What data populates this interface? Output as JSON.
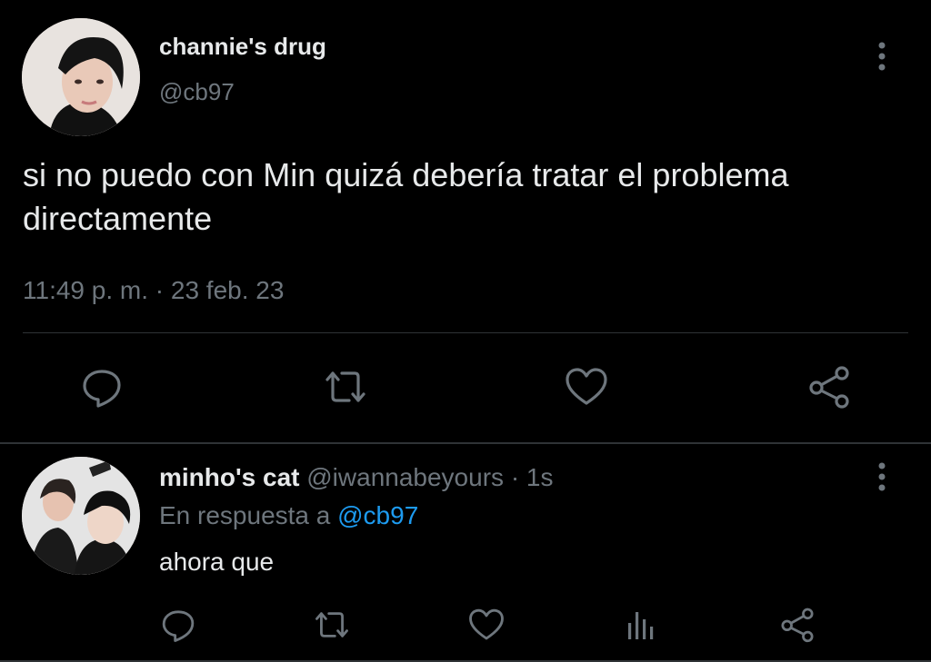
{
  "main_tweet": {
    "display_name": "channie's drug",
    "handle": "@cb97",
    "text_line1": "si no puedo con Min quizá debería tratar el problema",
    "text_line2": "directamente",
    "timestamp": "11:49 p. m. · 23 feb. 23"
  },
  "reply": {
    "display_name": "minho's cat",
    "handle": "@iwannabeyours",
    "separator": "·",
    "time": "1s",
    "in_reply_prefix": "En respuesta a",
    "in_reply_handle": "@cb97",
    "text": "ahora que"
  },
  "icons": {
    "more": "more-vertical-icon",
    "reply": "reply-bubble-icon",
    "retweet": "retweet-icon",
    "like": "heart-icon",
    "analytics": "analytics-bars-icon",
    "share": "share-icon"
  },
  "colors": {
    "background": "#000000",
    "text": "#e7e9ea",
    "muted": "#6e767d",
    "link": "#1d9bf0",
    "divider": "#2f3336"
  }
}
